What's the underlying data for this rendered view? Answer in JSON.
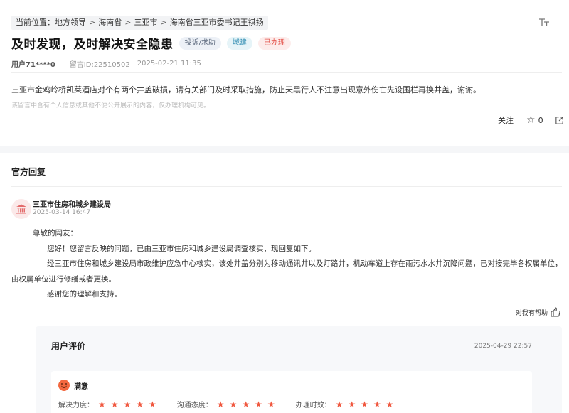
{
  "breadcrumb": {
    "prefix": "当前位置：",
    "items": [
      "地方领导",
      "海南省",
      "三亚市",
      "海南省三亚市委书记王祺扬"
    ],
    "sep": ">"
  },
  "header": {
    "title": "及时发现，及时解决安全隐患",
    "tags": {
      "type": "投诉/求助",
      "domain": "城建",
      "status": "已办理"
    }
  },
  "meta": {
    "user": "用户71****0",
    "message_id": "留言ID:22510502",
    "time": "2025-02-21 11:35"
  },
  "message": {
    "content": "三亚市金鸡岭桥凯莱酒店对个有两个井盖破损，请有关部门及时采取措施，防止天黑行人不注意出现意外伤亡先设围栏再换井盖，谢谢。",
    "privacy_note": "该留言中含有个人信息或其他不便公开展示的内容，仅办理机构可见。"
  },
  "actions": {
    "follow": "关注",
    "like_count": "0"
  },
  "reply_section": {
    "title": "官方回复",
    "dept": "三亚市住房和城乡建设局",
    "time": "2025-03-14 16:47",
    "greeting": "尊敬的网友：",
    "p1": "您好！您留言反映的问题，已由三亚市住房和城乡建设局调查核实，现回复如下。",
    "p2": "经三亚市住房和城乡建设局市政维护应急中心核实，该处井盖分别为移动通讯井以及灯路井，机动车道上存在雨污水水井沉降问题，已对接完毕各权属单位，由权属单位进行修缮或者更换。",
    "p3": "感谢您的理解和支持。",
    "helpful": "对我有帮助"
  },
  "evaluation": {
    "title": "用户评价",
    "time": "2025-04-29 22:57",
    "satisfaction": "满意",
    "ratings": [
      {
        "label": "解决力度：",
        "stars": 5
      },
      {
        "label": "沟通态度：",
        "stars": 5
      },
      {
        "label": "办理时效：",
        "stars": 5
      }
    ]
  },
  "colors": {
    "accent_red": "#e4544c",
    "star": "#f0583f",
    "blue_tag": "#3690b4"
  },
  "icons": {
    "font_size": "font-size-icon",
    "star": "star-icon",
    "share": "share-icon",
    "thumbs_up": "thumbs-up-icon",
    "dept": "government-building-icon"
  }
}
